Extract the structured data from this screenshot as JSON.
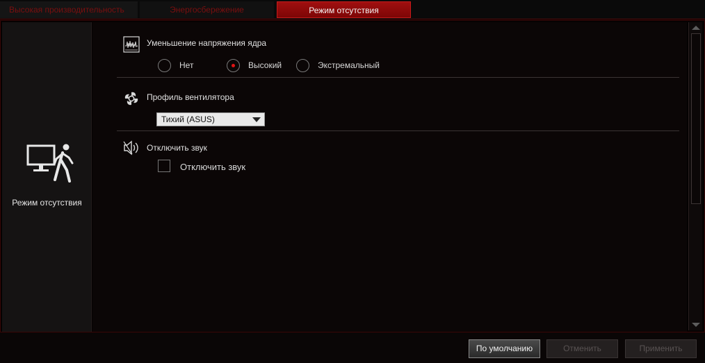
{
  "tabs": [
    {
      "label": "Высокая производительность",
      "active": false
    },
    {
      "label": "Энергосбережение",
      "active": false
    },
    {
      "label": "Режим отсутствия",
      "active": true
    }
  ],
  "left_panel": {
    "icon": "monitor-walking-person-icon",
    "label": "Режим отсутствия"
  },
  "core_voltage": {
    "title": "Уменьшение напряжения ядра",
    "icon": "waveform-chart-icon",
    "options": [
      "Нет",
      "Высокий",
      "Экстремальный"
    ],
    "selected": "Высокий"
  },
  "fan_profile": {
    "title": "Профиль вентилятора",
    "icon": "fan-icon",
    "selected": "Тихий (ASUS)"
  },
  "mute": {
    "title": "Отключить звук",
    "icon": "speaker-mute-icon",
    "checkbox_label": "Отключить звук",
    "checked": false
  },
  "buttons": {
    "default": "По умолчанию",
    "cancel": "Отменить",
    "apply": "Применить"
  },
  "colors": {
    "accent": "#a00f0f",
    "tab_inactive_text": "#7a0f0f",
    "radio_selected": "#e01414"
  }
}
